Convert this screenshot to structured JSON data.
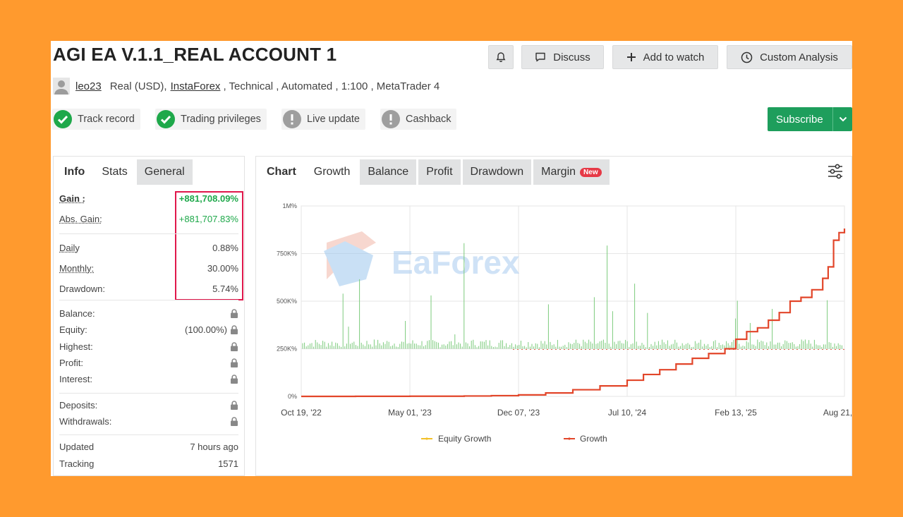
{
  "header": {
    "title": "AGI EA V.1.1_REAL ACCOUNT 1",
    "bell_icon": "bell-icon",
    "discuss_label": "Discuss",
    "add_watch_label": "Add to watch",
    "custom_analysis_label": "Custom Analysis"
  },
  "meta": {
    "user": "leo23",
    "account_type": "Real (USD),",
    "broker": "InstaForex",
    "tags": ", Technical , Automated , 1:100 , MetaTrader 4"
  },
  "badges": {
    "track_record": "Track record",
    "trading_privileges": "Trading privileges",
    "live_update": "Live update",
    "cashback": "Cashback"
  },
  "subscribe_label": "Subscribe",
  "left_tabs": [
    "Info",
    "Stats",
    "General"
  ],
  "stats": {
    "gain": {
      "label": "Gain :",
      "value": "+881,708.09%"
    },
    "abs_gain": {
      "label": "Abs. Gain:",
      "value": "+881,707.83%"
    },
    "daily": {
      "label": "Daily",
      "value": "0.88%"
    },
    "monthly": {
      "label": "Monthly:",
      "value": "30.00%"
    },
    "drawdown": {
      "label": "Drawdown:",
      "value": "5.74%"
    },
    "balance": {
      "label": "Balance:"
    },
    "equity": {
      "label": "Equity:",
      "value": "(100.00%)"
    },
    "highest": {
      "label": "Highest:"
    },
    "profit": {
      "label": "Profit:"
    },
    "interest": {
      "label": "Interest:"
    },
    "deposits": {
      "label": "Deposits:"
    },
    "withdrawals": {
      "label": "Withdrawals:"
    },
    "updated": {
      "label": "Updated",
      "value": "7 hours ago"
    },
    "tracking": {
      "label": "Tracking",
      "value": "1571"
    }
  },
  "chart_tabs": {
    "label": "Chart",
    "items": [
      "Growth",
      "Balance",
      "Profit",
      "Drawdown",
      "Margin"
    ],
    "new_badge": "New"
  },
  "watermark": "EaForex",
  "colors": {
    "growth": "#E2462A",
    "equity_growth": "#F2C029",
    "equity_bars": "#7CCB7C",
    "accent_green": "#1E9E5C",
    "highlight_box": "#E0174B",
    "page_background": "#FF9A2E"
  },
  "chart_data": {
    "type": "line",
    "title": "",
    "x_tick_labels": [
      "Oct 19, '22",
      "May 01, '23",
      "Dec 07, '23",
      "Jul 10, '24",
      "Feb 13, '25",
      "Aug 21, '25"
    ],
    "y_tick_labels": [
      "0%",
      "250K%",
      "500K%",
      "750K%",
      "1M%"
    ],
    "ylim": [
      0,
      1000000
    ],
    "grid": true,
    "legend_position": "bottom",
    "series": [
      {
        "name": "Growth",
        "x_fraction_of_range": [
          0,
          0.1,
          0.2,
          0.3,
          0.35,
          0.4,
          0.45,
          0.5,
          0.55,
          0.6,
          0.63,
          0.66,
          0.69,
          0.72,
          0.75,
          0.78,
          0.8,
          0.82,
          0.84,
          0.86,
          0.88,
          0.9,
          0.92,
          0.94,
          0.96,
          0.97,
          0.98,
          0.99,
          1.0
        ],
        "values": [
          0,
          500,
          1000,
          2000,
          4000,
          8000,
          18000,
          35000,
          55000,
          85000,
          115000,
          140000,
          170000,
          200000,
          225000,
          250000,
          300000,
          340000,
          360000,
          400000,
          440000,
          500000,
          520000,
          560000,
          620000,
          680000,
          820000,
          860000,
          881708
        ]
      },
      {
        "name": "Equity Growth",
        "note_visible": "equity bars drawn as green spikes around 250K%"
      }
    ]
  }
}
